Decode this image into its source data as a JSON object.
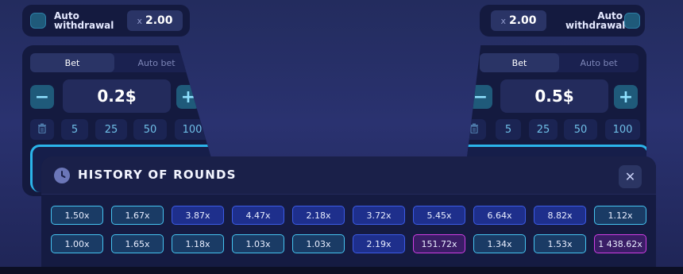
{
  "auto_withdrawal": {
    "left": {
      "label": "Auto withdrawal",
      "multiplier": "2.00",
      "x_symbol": "x"
    },
    "right": {
      "label": "Auto withdrawal",
      "multiplier": "2.00",
      "x_symbol": "x"
    }
  },
  "panels": {
    "left": {
      "tabs": [
        "Bet",
        "Auto bet"
      ],
      "amount": "0.2$",
      "minus": "−",
      "plus": "+",
      "quick": [
        "5",
        "25",
        "50",
        "100"
      ]
    },
    "right": {
      "tabs": [
        "Bet",
        "Auto bet"
      ],
      "amount": "0.5$",
      "minus": "−",
      "plus": "+",
      "quick": [
        "5",
        "25",
        "50",
        "100"
      ]
    }
  },
  "history": {
    "title": "HISTORY OF ROUNDS",
    "close": "✕",
    "rounds": [
      {
        "value": "1.50x",
        "color": "teal"
      },
      {
        "value": "1.67x",
        "color": "teal"
      },
      {
        "value": "3.87x",
        "color": "blue"
      },
      {
        "value": "4.47x",
        "color": "blue"
      },
      {
        "value": "2.18x",
        "color": "blue"
      },
      {
        "value": "3.72x",
        "color": "blue"
      },
      {
        "value": "5.45x",
        "color": "blue"
      },
      {
        "value": "6.64x",
        "color": "blue"
      },
      {
        "value": "8.82x",
        "color": "blue"
      },
      {
        "value": "1.12x",
        "color": "teal"
      },
      {
        "value": "1.00x",
        "color": "teal"
      },
      {
        "value": "1.65x",
        "color": "teal"
      },
      {
        "value": "1.18x",
        "color": "teal"
      },
      {
        "value": "1.03x",
        "color": "teal"
      },
      {
        "value": "1.03x",
        "color": "teal"
      },
      {
        "value": "2.19x",
        "color": "blue"
      },
      {
        "value": "151.72x",
        "color": "magenta"
      },
      {
        "value": "1.34x",
        "color": "teal"
      },
      {
        "value": "1.53x",
        "color": "teal"
      },
      {
        "value": "1 438.62x",
        "color": "magenta"
      }
    ]
  },
  "colors": {
    "accent": "#2bb4ea",
    "teal_chip": "#45c3f0",
    "blue_chip": "#3c5ce6",
    "magenta_chip": "#d03ee4"
  },
  "icons": {
    "clock": "clock-icon",
    "close": "close-icon",
    "trash": "trash-icon"
  }
}
